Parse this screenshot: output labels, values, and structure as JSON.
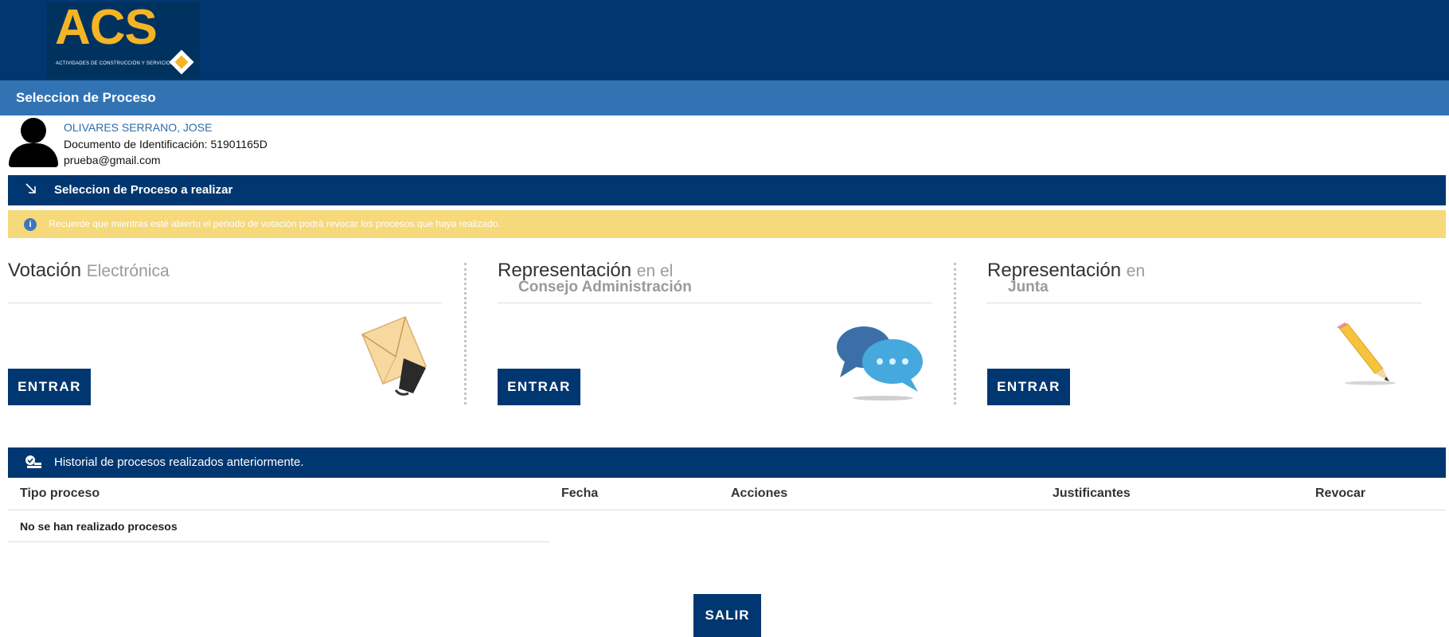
{
  "brand": {
    "logo_text": "ACS",
    "logo_subtitle": "ACTIVIDADES DE CONSTRUCCIÓN Y SERVICIOS",
    "logo_color": "#f3b425"
  },
  "page": {
    "title": "Seleccion de Proceso"
  },
  "user": {
    "name": "OLIVARES SERRANO, JOSE",
    "document": "Documento de Identificación: 51901165D",
    "email": "prueba@gmail.com",
    "avatar_icon": "user-silhouette-icon"
  },
  "process_section": {
    "title": "Seleccion de Proceso a realizar",
    "icon": "arrow-down-right-icon",
    "notice": "Recuerde que mientras esté abierto el periodo de votación podrá revocar los procesos que haya realizado."
  },
  "options": [
    {
      "title_main": "Votación",
      "title_light": "Electrónica",
      "title_line2": "",
      "button": "ENTRAR",
      "icon": "envelope-icon"
    },
    {
      "title_main": "Representación",
      "title_light": "en el",
      "title_line2": "Consejo Administración",
      "button": "ENTRAR",
      "icon": "chat-bubbles-icon"
    },
    {
      "title_main": "Representación",
      "title_light": "en",
      "title_line2": "Junta",
      "button": "ENTRAR",
      "icon": "pencil-icon"
    }
  ],
  "history": {
    "title": "Historial de procesos realizados anteriormente.",
    "icon": "history-icon",
    "columns": [
      "Tipo proceso",
      "Fecha",
      "Acciones",
      "Justificantes",
      "Revocar"
    ],
    "empty_message": "No se han realizado procesos"
  },
  "footer": {
    "exit_label": "SALIR"
  },
  "colors": {
    "header_navy": "#003770",
    "title_blue": "#3273b4",
    "notice_yellow": "#f5d97a"
  }
}
